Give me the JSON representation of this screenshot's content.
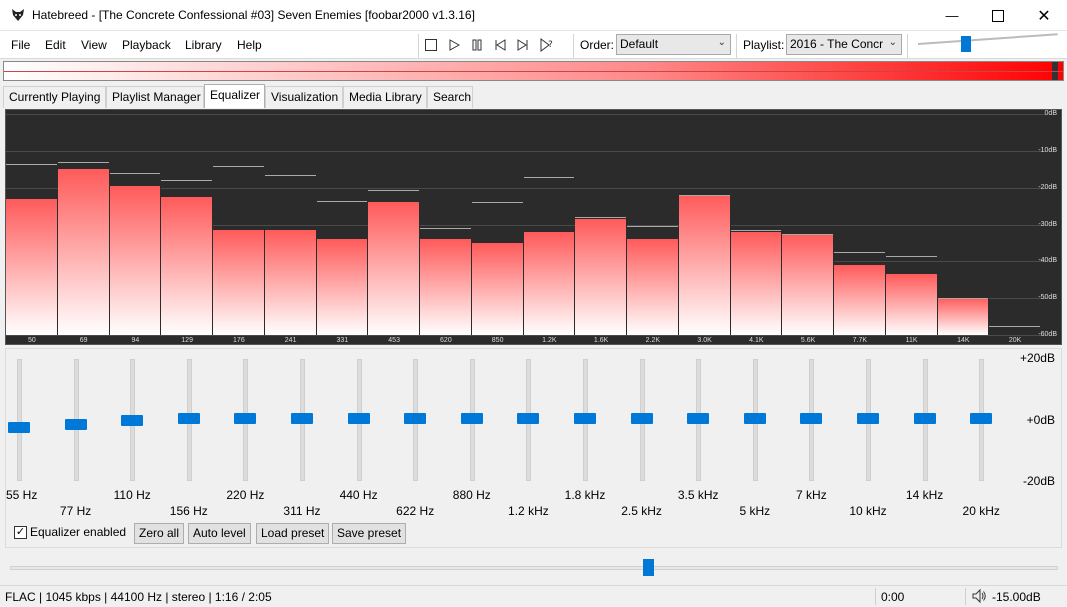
{
  "window": {
    "title": "Hatebreed - [The Concrete Confessional #03] Seven Enemies  [foobar2000 v1.3.16]"
  },
  "menu": [
    "File",
    "Edit",
    "View",
    "Playback",
    "Library",
    "Help"
  ],
  "toolbar": {
    "order_label": "Order:",
    "order_value": "Default",
    "playlist_label": "Playlist:",
    "playlist_value": "2016 - The Concr"
  },
  "tabs": [
    "Currently Playing",
    "Playlist Manager",
    "Equalizer",
    "Visualization",
    "Media Library",
    "Search"
  ],
  "active_tab": "Equalizer",
  "spectrum": {
    "db_labels": [
      "0dB",
      "-10dB",
      "-20dB",
      "-30dB",
      "-40dB",
      "-50dB",
      "-60dB"
    ],
    "bands": [
      {
        "label": "50",
        "level": -23,
        "peak": -13.5
      },
      {
        "label": "69",
        "level": -15,
        "peak": -13
      },
      {
        "label": "94",
        "level": -19.5,
        "peak": -16
      },
      {
        "label": "129",
        "level": -22.5,
        "peak": -18
      },
      {
        "label": "176",
        "level": -31.5,
        "peak": -14
      },
      {
        "label": "241",
        "level": -31.5,
        "peak": -16.5
      },
      {
        "label": "331",
        "level": -34,
        "peak": -23.5
      },
      {
        "label": "453",
        "level": -24,
        "peak": -20.5
      },
      {
        "label": "620",
        "level": -34,
        "peak": -31
      },
      {
        "label": "850",
        "level": -35,
        "peak": -24
      },
      {
        "label": "1.2K",
        "level": -32,
        "peak": -17
      },
      {
        "label": "1.6K",
        "level": -28.5,
        "peak": -28
      },
      {
        "label": "2.2K",
        "level": -34,
        "peak": -30.5
      },
      {
        "label": "3.0K",
        "level": -22,
        "peak": -22
      },
      {
        "label": "4.1K",
        "level": -32,
        "peak": -31.5
      },
      {
        "label": "5.6K",
        "level": -32.5,
        "peak": -32.5
      },
      {
        "label": "7.7K",
        "level": -41,
        "peak": -37.5
      },
      {
        "label": "11K",
        "level": -43.5,
        "peak": -38.5
      },
      {
        "label": "14K",
        "level": -50,
        "peak": -50
      },
      {
        "label": "20K",
        "level": -60,
        "peak": -57.5
      }
    ]
  },
  "equalizer": {
    "db_top": "+20dB",
    "db_mid": "+0dB",
    "db_bottom": "-20dB",
    "bands": [
      {
        "label": "55 Hz",
        "gain": -3
      },
      {
        "label": "77 Hz",
        "gain": -2
      },
      {
        "label": "110 Hz",
        "gain": -0.5
      },
      {
        "label": "156 Hz",
        "gain": 0
      },
      {
        "label": "220 Hz",
        "gain": 0
      },
      {
        "label": "311 Hz",
        "gain": 0
      },
      {
        "label": "440 Hz",
        "gain": 0
      },
      {
        "label": "622 Hz",
        "gain": 0
      },
      {
        "label": "880 Hz",
        "gain": 0
      },
      {
        "label": "1.2 kHz",
        "gain": 0
      },
      {
        "label": "1.8 kHz",
        "gain": 0
      },
      {
        "label": "2.5 kHz",
        "gain": 0
      },
      {
        "label": "3.5 kHz",
        "gain": 0
      },
      {
        "label": "5 kHz",
        "gain": 0
      },
      {
        "label": "7 kHz",
        "gain": 0
      },
      {
        "label": "10 kHz",
        "gain": 0
      },
      {
        "label": "14 kHz",
        "gain": 0
      },
      {
        "label": "20 kHz",
        "gain": 0
      }
    ],
    "enabled_label": "Equalizer enabled",
    "enabled": true,
    "buttons": {
      "zero_all": "Zero all",
      "auto_level": "Auto level",
      "load_preset": "Load preset",
      "save_preset": "Save preset"
    }
  },
  "playback": {
    "seek_fraction": 0.99,
    "volume_slider_fraction": 0.61
  },
  "status": {
    "info": "FLAC | 1045 kbps | 44100 Hz | stereo | 1:16 / 2:05",
    "time": "0:00",
    "volume": "-15.00dB"
  },
  "colors": {
    "accent": "#0078d7",
    "spectrum_bg": "#2b2b2b",
    "bar_top": "#ff5a5a"
  }
}
